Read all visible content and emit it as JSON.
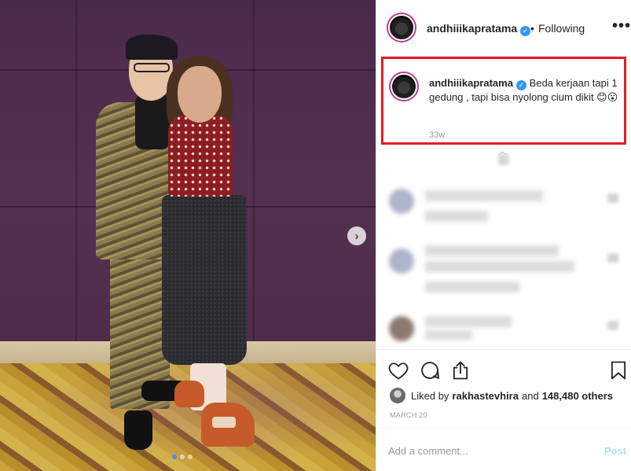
{
  "post": {
    "username": "andhiiikapratama",
    "bullet": "•",
    "follow_status": "Following",
    "more_label": "•••",
    "verified_mark": "✓"
  },
  "caption": {
    "username": "andhiiikapratama",
    "text": "Beda kerjaan tapi 1 gedung , tapi bisa nyolong cium dikit 😊😮",
    "time": "33w"
  },
  "carousel": {
    "next_arrow": "›",
    "dot_count": 3,
    "active_dot": 1
  },
  "likes": {
    "prefix": "Liked by",
    "first_user": "rakhastevhira",
    "conjunction": "and",
    "count_text": "148,480 others"
  },
  "date": "MARCH 20",
  "comment_input": {
    "placeholder": "Add a comment...",
    "post_label": "Post"
  },
  "icons": [
    "heart-icon",
    "comment-icon",
    "share-icon",
    "bookmark-icon",
    "verified-icon",
    "more-options-icon",
    "chevron-right-icon"
  ],
  "colors": {
    "accent_blue": "#3897f0",
    "highlight_red": "#e31b23",
    "post_button_disabled": "#b2dffc",
    "meta_gray": "#999999"
  }
}
